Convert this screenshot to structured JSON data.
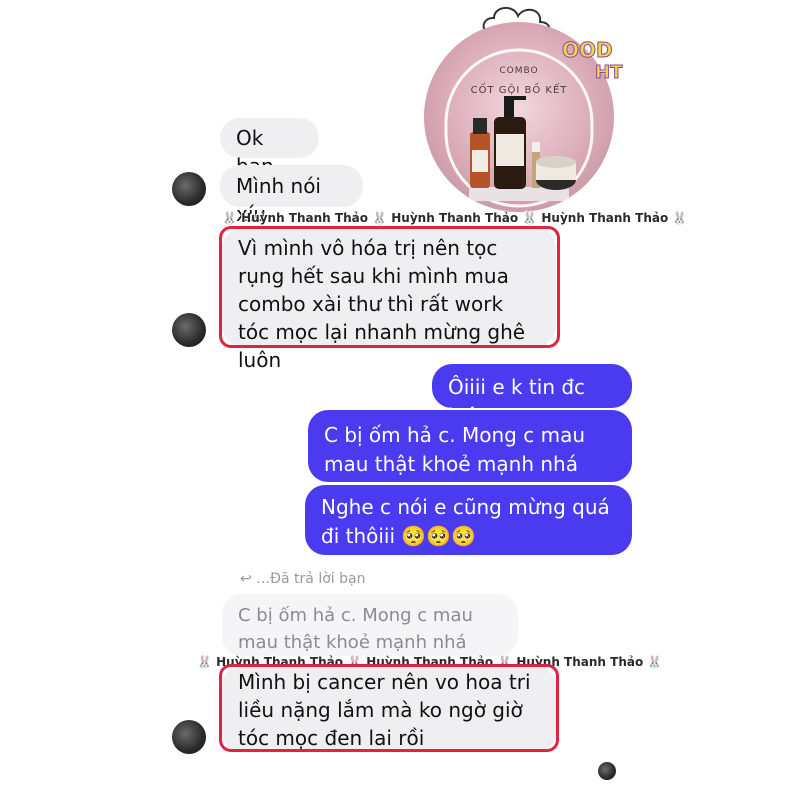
{
  "promo": {
    "line1": "COMBO",
    "line2": "CỐT GỘI BỒ KẾT",
    "sticker_top": "OOD",
    "sticker_bottom": "HT"
  },
  "messages": {
    "m1": "Ok ban",
    "m2": "Mình nói xíu",
    "m3": "Vì mình vô hóa trị nên tọc rụng hết sau khi mình mua combo xài thư thì rất work tóc mọc lại nhanh mừng ghê luôn",
    "m4": "Ôiiii e k tin đc luôn",
    "m5": "C bị ốm hả c. Mong c mau mau thật khoẻ mạnh nhá",
    "m6": "Nghe c nói e cũng mừng quá đi thôiii 🥺🥺🥺",
    "reply_label": "↩ …Đã trả lời bạn",
    "reply_quote": "C bị ốm hả c. Mong c mau mau thật khoẻ mạnh nhá",
    "m7": "Mình bị cancer nên vo hoa tri liều nặng lắm mà ko ngờ giờ tóc mọc đen lai rồi"
  },
  "watermark": {
    "line1": "🐰 Huỳnh Thanh Thảo 🐰 Huỳnh Thanh Thảo 🐰 Huỳnh Thanh Thảo 🐰",
    "line2": "🐰 Huỳnh Thanh Thảo 🐰 Huỳnh Thanh Thảo 🐰 Huỳnh Thanh Thảo 🐰"
  },
  "colors": {
    "outgoing": "#4a3bf0",
    "incoming": "#efeff1",
    "highlight": "#e0243f"
  }
}
